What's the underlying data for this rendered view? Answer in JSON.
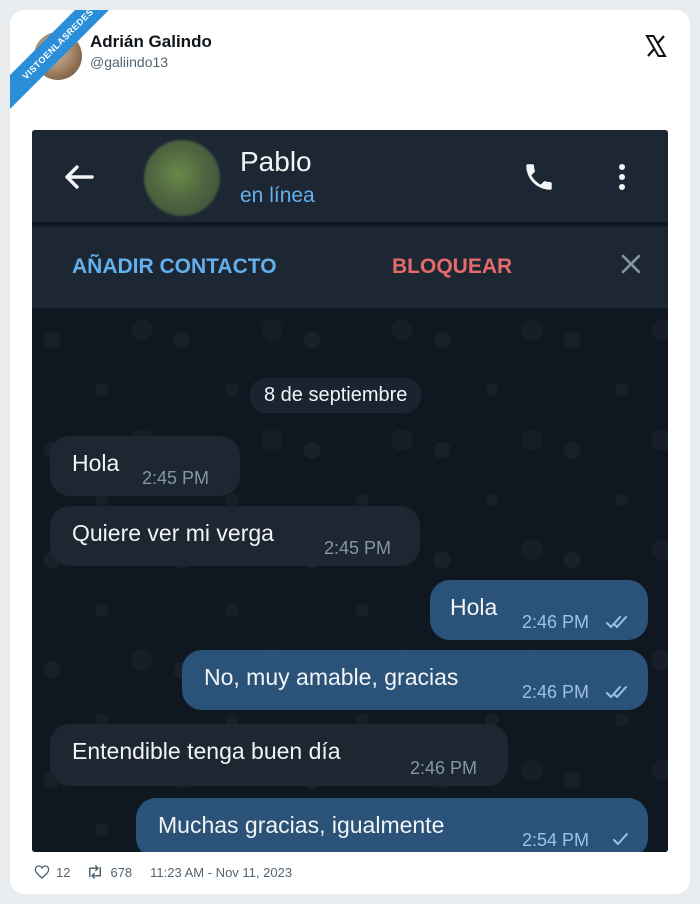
{
  "watermark": "VISTOENLASREDES",
  "tweet": {
    "author_name": "Adrián Galindo",
    "author_handle": "@galiindo13",
    "likes": "12",
    "retweets": "678",
    "timestamp": "11:23 AM - Nov 11, 2023"
  },
  "telegram": {
    "contact_name": "Pablo",
    "contact_status": "en línea",
    "add_contact_label": "AÑADIR CONTACTO",
    "block_label": "BLOQUEAR",
    "date_separator": "8 de septiembre",
    "messages": [
      {
        "direction": "in",
        "text": "Hola",
        "time": "2:45 PM"
      },
      {
        "direction": "in",
        "text": "Quiere ver mi verga",
        "time": "2:45 PM"
      },
      {
        "direction": "out",
        "text": "Hola",
        "time": "2:46 PM",
        "status": "read"
      },
      {
        "direction": "out",
        "text": "No, muy amable, gracias",
        "time": "2:46 PM",
        "status": "read"
      },
      {
        "direction": "in",
        "text": "Entendible tenga buen día",
        "time": "2:46 PM"
      },
      {
        "direction": "out",
        "text": "Muchas gracias, igualmente",
        "time": "2:54 PM",
        "status": "sent"
      }
    ]
  },
  "colors": {
    "header_bg": "#1c2733",
    "chat_bg": "#0f1720",
    "incoming_bubble": "#1d2731",
    "outgoing_bubble": "#2b5278",
    "accent_blue": "#64b0ec",
    "block_red": "#e56a6a"
  }
}
